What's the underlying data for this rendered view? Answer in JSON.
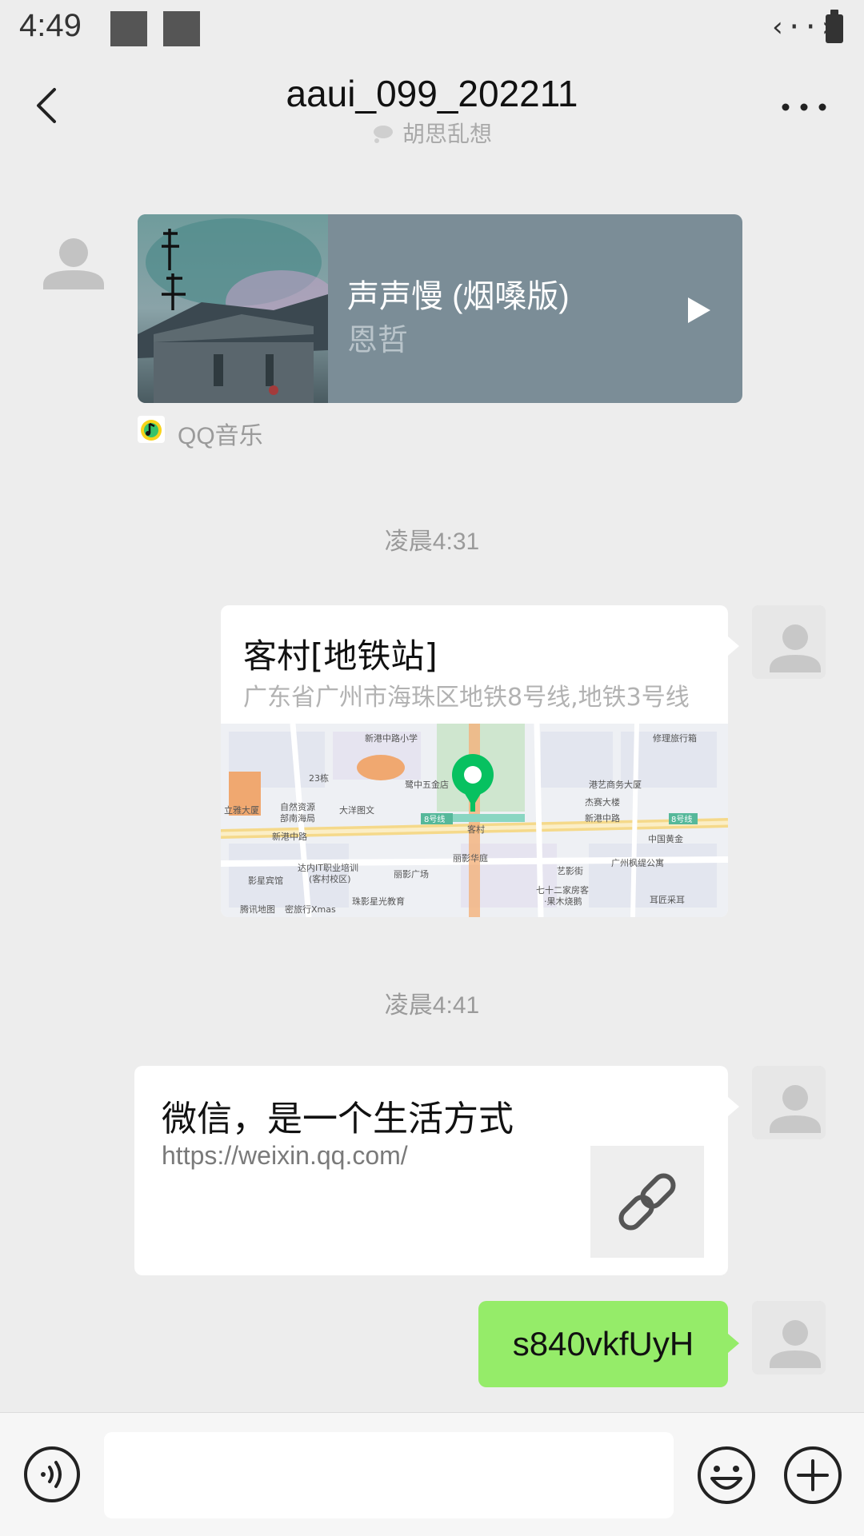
{
  "status_bar": {
    "time": "4:49",
    "network": "‹··›"
  },
  "header": {
    "title": "aaui_099_202211",
    "subtitle": "胡思乱想"
  },
  "messages": {
    "music": {
      "title": "声声慢 (烟嗓版)",
      "artist": "恩哲",
      "source": "QQ音乐"
    },
    "timestamp_1": "凌晨4:31",
    "location": {
      "title": "客村[地铁站]",
      "address": "广东省广州市海珠区地铁8号线,地铁3号线"
    },
    "timestamp_2": "凌晨4:41",
    "link": {
      "title": "微信，是一个生活方式",
      "url": "https://weixin.qq.com/"
    },
    "text": "s840vkfUyH"
  },
  "input_bar": {
    "placeholder": ""
  },
  "colors": {
    "background": "#ededed",
    "music_card": "#7b8d97",
    "sent_bubble": "#95ec69",
    "map_marker": "#07c160"
  },
  "icons": [
    "back-icon",
    "more-icon",
    "chat-bubble-icon",
    "avatar-icon",
    "play-icon",
    "qq-music-icon",
    "map-pin-icon",
    "link-icon",
    "voice-icon",
    "emoji-icon",
    "plus-icon"
  ]
}
